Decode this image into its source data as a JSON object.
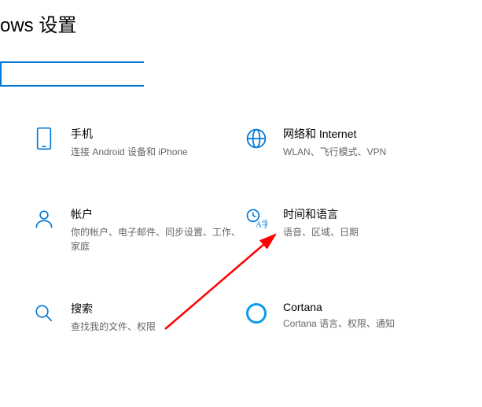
{
  "header": {
    "title": "ows 设置"
  },
  "search": {
    "placeholder": ""
  },
  "tiles": {
    "phone": {
      "title": "手机",
      "desc": "连接 Android 设备和 iPhone"
    },
    "network": {
      "title": "网络和 Internet",
      "desc": "WLAN、飞行模式、VPN"
    },
    "account": {
      "title": "帐户",
      "desc": "你的帐户、电子邮件、同步设置、工作、家庭"
    },
    "time": {
      "title": "时间和语言",
      "desc": "语音、区域、日期"
    },
    "searchT": {
      "title": "搜索",
      "desc": "查找我的文件、权限"
    },
    "cortana": {
      "title": "Cortana",
      "desc": "Cortana 语言、权限、通知"
    }
  }
}
